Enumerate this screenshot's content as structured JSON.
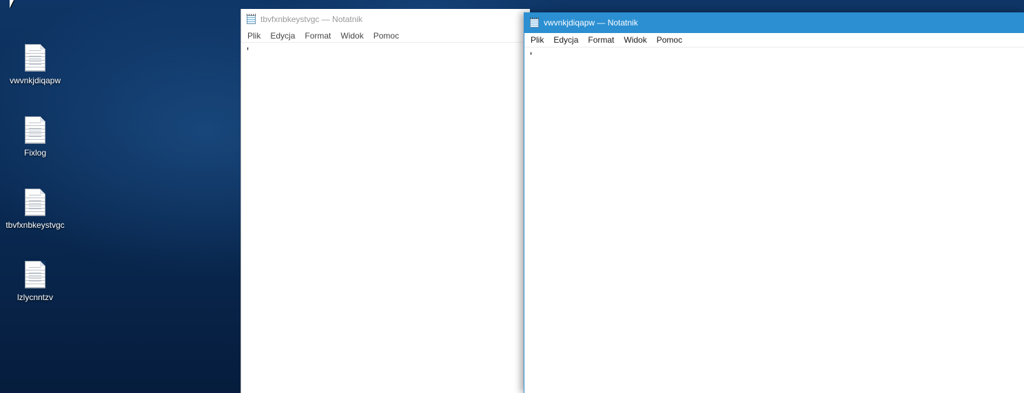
{
  "desktop": {
    "icons": [
      {
        "label": "vwvnkjdiqapw",
        "icon": "text-file-icon"
      },
      {
        "label": "Fixlog",
        "icon": "text-file-icon"
      },
      {
        "label": "tbvfxnbkeystvgc",
        "icon": "text-file-icon"
      },
      {
        "label": "lzlycnntzv",
        "icon": "text-file-icon"
      }
    ]
  },
  "windows": [
    {
      "title": "tbvfxnbkeystvgc — Notatnik",
      "active": false,
      "menu": [
        "Plik",
        "Edycja",
        "Format",
        "Widok",
        "Pomoc"
      ],
      "content": "'"
    },
    {
      "title": "vwvnkjdiqapw — Notatnik",
      "active": true,
      "menu": [
        "Plik",
        "Edycja",
        "Format",
        "Widok",
        "Pomoc"
      ],
      "content": "'"
    }
  ],
  "colors": {
    "active_titlebar": "#2b8fd2",
    "inactive_title_text": "#9a9a9a",
    "desktop_bg": "#0b2a52"
  }
}
